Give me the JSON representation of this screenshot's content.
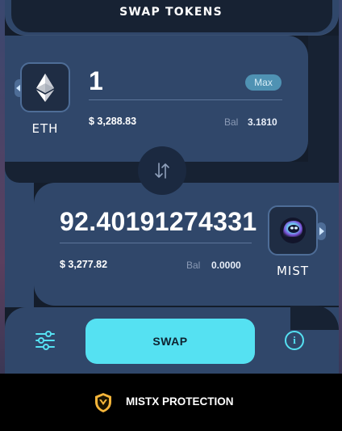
{
  "header": {
    "title": "SWAP TOKENS"
  },
  "from": {
    "symbol": "ETH",
    "amount": "1",
    "max_label": "Max",
    "usd_value": "$ 3,288.83",
    "balance_label": "Bal",
    "balance_value": "3.1810"
  },
  "to": {
    "symbol": "MIST",
    "amount": "92.40191274331",
    "usd_value": "$ 3,277.82",
    "balance_label": "Bal",
    "balance_value": "0.0000"
  },
  "actions": {
    "swap_label": "SWAP",
    "info_label": "i"
  },
  "footer": {
    "protection_label": "MISTX PROTECTION"
  },
  "colors": {
    "accent": "#55e1f2",
    "card": "#30476a",
    "background": "#172233",
    "shield": "#f5b53a"
  },
  "icons": {
    "from_token": "ethereum-icon",
    "to_token": "mist-icon",
    "switch": "swap-arrows-icon",
    "settings": "sliders-icon",
    "info": "info-icon",
    "protection": "shield-icon"
  }
}
